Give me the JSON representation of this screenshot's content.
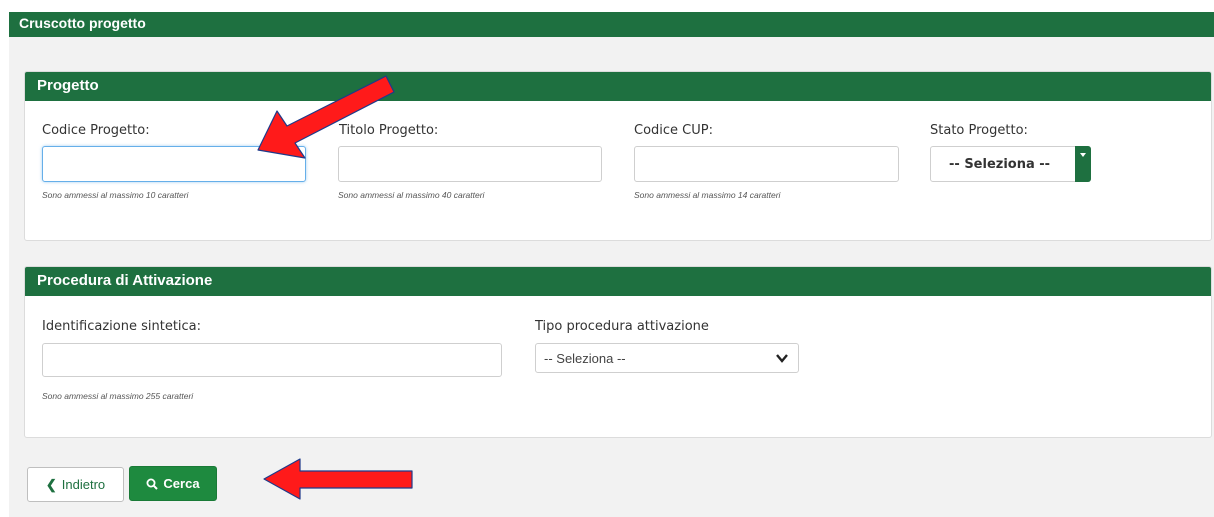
{
  "header": {
    "title": "Cruscotto progetto"
  },
  "progetto_panel": {
    "title": "Progetto",
    "fields": [
      {
        "label": "Codice Progetto:",
        "value": "",
        "help": "Sono ammessi al massimo 10 caratteri"
      },
      {
        "label": "Titolo Progetto:",
        "value": "",
        "help": "Sono ammessi al massimo 40 caratteri"
      },
      {
        "label": "Codice CUP:",
        "value": "",
        "help": "Sono ammessi al massimo 14 caratteri"
      }
    ],
    "stato": {
      "label": "Stato Progetto:",
      "selected": "-- Seleziona --"
    }
  },
  "procedura_panel": {
    "title": "Procedura di Attivazione",
    "identificazione": {
      "label": "Identificazione sintetica:",
      "value": "",
      "help": "Sono ammessi al massimo 255 caratteri"
    },
    "tipo": {
      "label": "Tipo procedura attivazione",
      "selected": "-- Seleziona --"
    }
  },
  "actions": {
    "back_label": "Indietro",
    "search_label": "Cerca"
  },
  "colors": {
    "brand_green": "#1e7040",
    "button_green": "#1e8a3f",
    "annotation_red": "#ff0000"
  },
  "icons": {
    "back": "chevron-left-icon",
    "search": "search-icon",
    "select": "chevron-down-icon"
  }
}
